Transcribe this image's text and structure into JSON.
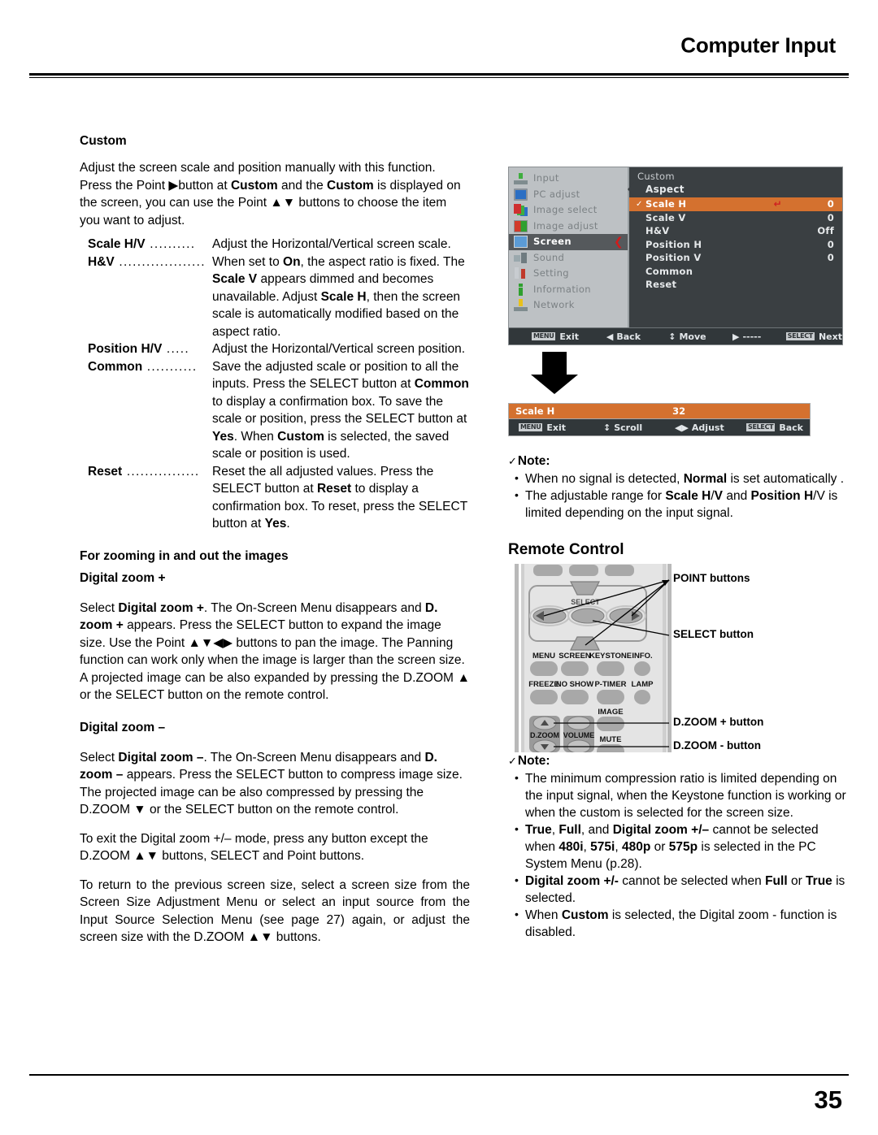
{
  "header": {
    "title": "Computer Input"
  },
  "footer": {
    "page_number": "35"
  },
  "left": {
    "section_heading": "Custom",
    "intro_p1": "Adjust the screen scale and position manually with this function.",
    "intro_p2_a": "Press the Point ",
    "intro_p2_arrow": "▶",
    "intro_p2_b": "button at ",
    "intro_p2_bold1": "Custom",
    "intro_p2_c": " and the ",
    "intro_p2_bold2": "Custom",
    "intro_p2_d": " is displayed on the screen, you can use the Point ▲▼ buttons to choose the item you want to adjust.",
    "definitions": [
      {
        "term": "Scale H/V",
        "dots": " ..........",
        "desc": "Adjust the Horizontal/Vertical screen scale."
      },
      {
        "term": "H&V",
        "dots": " ...................",
        "desc": "When set to On, the aspect ratio is fixed. The Scale V appears dimmed and becomes unavailable. Adjust Scale H, then the screen scale is automatically modified based on the aspect ratio."
      },
      {
        "term": "Position H/V",
        "dots": " .....",
        "desc": "Adjust the Horizontal/Vertical screen position."
      },
      {
        "term": "Common",
        "dots": " ...........",
        "desc": "Save the adjusted scale or position to all the inputs. Press the SELECT button at Common to display a confirmation box. To save the scale or position, press the SELECT button at Yes. When Custom is selected, the saved scale or position is used."
      },
      {
        "term": "Reset",
        "dots": " ................",
        "desc": "Reset the all adjusted values. Press the SELECT button at Reset to display a confirmation box. To reset, press the SELECT button at Yes."
      }
    ],
    "zoom_heading": "For zooming in and out the images",
    "dzoom_plus_heading": "Digital zoom +",
    "dzoom_plus_p1": "Select Digital zoom +. The On-Screen Menu disappears and D. zoom + appears. Press the SELECT button to expand the image size. Use the Point ▲▼◀▶ buttons to pan the image. The Panning function can work only when the image is larger than the screen size.",
    "dzoom_plus_p2": "A projected image can be also expanded by pressing the D.ZOOM ▲ or the SELECT button on the remote control.",
    "dzoom_minus_heading": "Digital zoom –",
    "dzoom_minus_p1": "Select Digital zoom –. The On-Screen Menu disappears and D. zoom – appears. Press the SELECT button to compress image size.",
    "dzoom_minus_p2": "The projected image can be also compressed by pressing the D.ZOOM ▼ or the SELECT button on the remote control.",
    "exit_p": "To exit the Digital zoom +/– mode, press any button except the D.ZOOM ▲▼ buttons, SELECT and Point buttons.",
    "return_p": "To return to the previous screen size, select a screen size from the Screen Size Adjustment Menu or select an input source from the Input Source Selection Menu (see page 27) again, or adjust the screen size with the D.ZOOM ▲▼ buttons."
  },
  "osd_menu": {
    "sidebar": [
      {
        "label": "Input",
        "icon": "input-icon",
        "active": false
      },
      {
        "label": "PC adjust",
        "icon": "pc-adjust-icon",
        "active": false
      },
      {
        "label": "Image select",
        "icon": "image-select-icon",
        "active": false
      },
      {
        "label": "Image adjust",
        "icon": "image-adjust-icon",
        "active": false
      },
      {
        "label": "Screen",
        "icon": "screen-icon",
        "active": true
      },
      {
        "label": "Sound",
        "icon": "sound-icon",
        "active": false
      },
      {
        "label": "Setting",
        "icon": "setting-icon",
        "active": false
      },
      {
        "label": "Information",
        "icon": "information-icon",
        "active": false
      },
      {
        "label": "Network",
        "icon": "network-icon",
        "active": false
      }
    ],
    "active_chevron": "❮",
    "panel_title": "Custom",
    "panel_subtitle": "Aspect",
    "rows": [
      {
        "name": "Scale H",
        "value": "0",
        "highlighted": true,
        "check": "✓",
        "enter": "↵"
      },
      {
        "name": "Scale V",
        "value": "0",
        "highlighted": false,
        "check": "",
        "enter": ""
      },
      {
        "name": "H&V",
        "value": "Off",
        "highlighted": false,
        "check": "",
        "enter": ""
      },
      {
        "name": "Position H",
        "value": "0",
        "highlighted": false,
        "check": "",
        "enter": ""
      },
      {
        "name": "Position V",
        "value": "0",
        "highlighted": false,
        "check": "",
        "enter": ""
      },
      {
        "name": "Common",
        "value": "",
        "highlighted": false,
        "check": "",
        "enter": ""
      },
      {
        "name": "Reset",
        "value": "",
        "highlighted": false,
        "check": "",
        "enter": ""
      }
    ],
    "status_bar": [
      {
        "key": "MENU",
        "glyph": "",
        "label": "Exit"
      },
      {
        "key": "",
        "glyph": "◀",
        "label": "Back"
      },
      {
        "key": "",
        "glyph": "↕",
        "label": "Move"
      },
      {
        "key": "",
        "glyph": "▶",
        "label": "-----"
      },
      {
        "key": "SELECT",
        "glyph": "",
        "label": "Next"
      }
    ],
    "colors": {
      "highlight": "#d4712f",
      "panel_bg": "#3a3f42",
      "sidebar_bg": "#bdc1c4",
      "chevron": "#d01c1c"
    }
  },
  "osd_bar": {
    "name": "Scale H",
    "value": "32",
    "status_bar": [
      {
        "key": "MENU",
        "glyph": "",
        "label": "Exit"
      },
      {
        "key": "",
        "glyph": "↕",
        "label": "Scroll"
      },
      {
        "key": "",
        "glyph": "◀▶",
        "label": "Adjust"
      },
      {
        "key": "SELECT",
        "glyph": "",
        "label": "Back"
      }
    ]
  },
  "note_top": {
    "title": "Note:",
    "check": "✓",
    "items": [
      "When no signal is detected, Normal is set automatically .",
      "The adjustable range for Scale H/V and Position H/V is limited depending on the input signal."
    ]
  },
  "remote": {
    "title": "Remote Control",
    "callouts": [
      {
        "label": "POINT buttons"
      },
      {
        "label": "SELECT button"
      },
      {
        "label": "D.ZOOM + button"
      },
      {
        "label": "D.ZOOM - button"
      }
    ],
    "button_labels": {
      "select": "SELECT",
      "menu": "MENU",
      "screen": "SCREEN",
      "keystone": "KEYSTONE",
      "info": "INFO.",
      "freeze": "FREEZE",
      "noshow": "NO SHOW",
      "ptimer": "P-TIMER",
      "lamp": "LAMP",
      "image": "IMAGE",
      "dzoom": "D.ZOOM",
      "volume": "VOLUME",
      "mute": "MUTE"
    }
  },
  "note_bottom": {
    "title": "Note:",
    "check": "✓",
    "items": [
      "The minimum compression ratio is limited depending on the input signal, when the Keystone function is working or when the custom is selected for the screen size.",
      "True, Full, and Digital zoom +/– cannot be selected when 480i, 575i, 480p or 575p is selected in the PC System Menu (p.28).",
      "Digital zoom +/- cannot be selected when Full or True is selected.",
      "When Custom is selected, the Digital zoom - function is disabled."
    ]
  }
}
